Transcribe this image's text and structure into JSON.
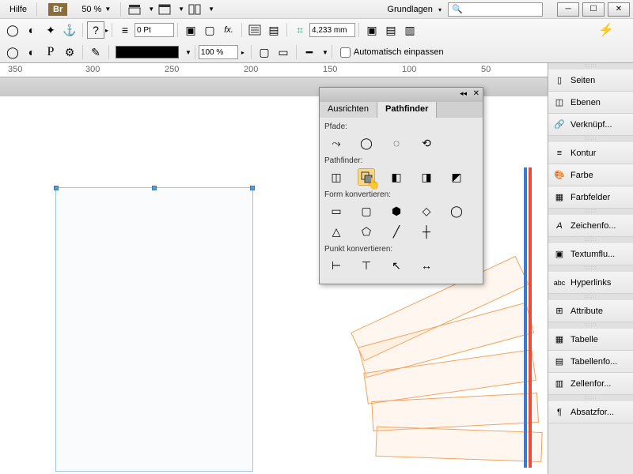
{
  "menu": {
    "help": "Hilfe"
  },
  "zoom": "50 %",
  "workspace_label": "Grundlagen",
  "search_placeholder": "",
  "toolbar": {
    "stroke_value": "0 Pt",
    "opacity_value": "100 %",
    "measure_value": "4,233 mm",
    "autofit_label": "Automatisch einpassen"
  },
  "ruler_ticks": [
    "350",
    "300",
    "250",
    "200",
    "150",
    "100",
    "50"
  ],
  "right_panels": [
    {
      "label": "Seiten",
      "icon": "pages"
    },
    {
      "label": "Ebenen",
      "icon": "layers"
    },
    {
      "label": "Verknüpf...",
      "icon": "links"
    },
    {
      "label": "Kontur",
      "icon": "stroke"
    },
    {
      "label": "Farbe",
      "icon": "color"
    },
    {
      "label": "Farbfelder",
      "icon": "swatches"
    },
    {
      "label": "Zeichenfo...",
      "icon": "char"
    },
    {
      "label": "Textumflu...",
      "icon": "wrap"
    },
    {
      "label": "Hyperlinks",
      "icon": "hyperlink"
    },
    {
      "label": "Attribute",
      "icon": "attributes"
    },
    {
      "label": "Tabelle",
      "icon": "table"
    },
    {
      "label": "Tabellenfo...",
      "icon": "tablefmt"
    },
    {
      "label": "Zellenfor...",
      "icon": "cellfmt"
    },
    {
      "label": "Absatzfor...",
      "icon": "para"
    }
  ],
  "pathfinder_panel": {
    "tab1": "Ausrichten",
    "tab2": "Pathfinder",
    "section_paths": "Pfade:",
    "section_pathfinder": "Pathfinder:",
    "section_convert_shape": "Form konvertieren:",
    "section_convert_point": "Punkt konvertieren:"
  }
}
